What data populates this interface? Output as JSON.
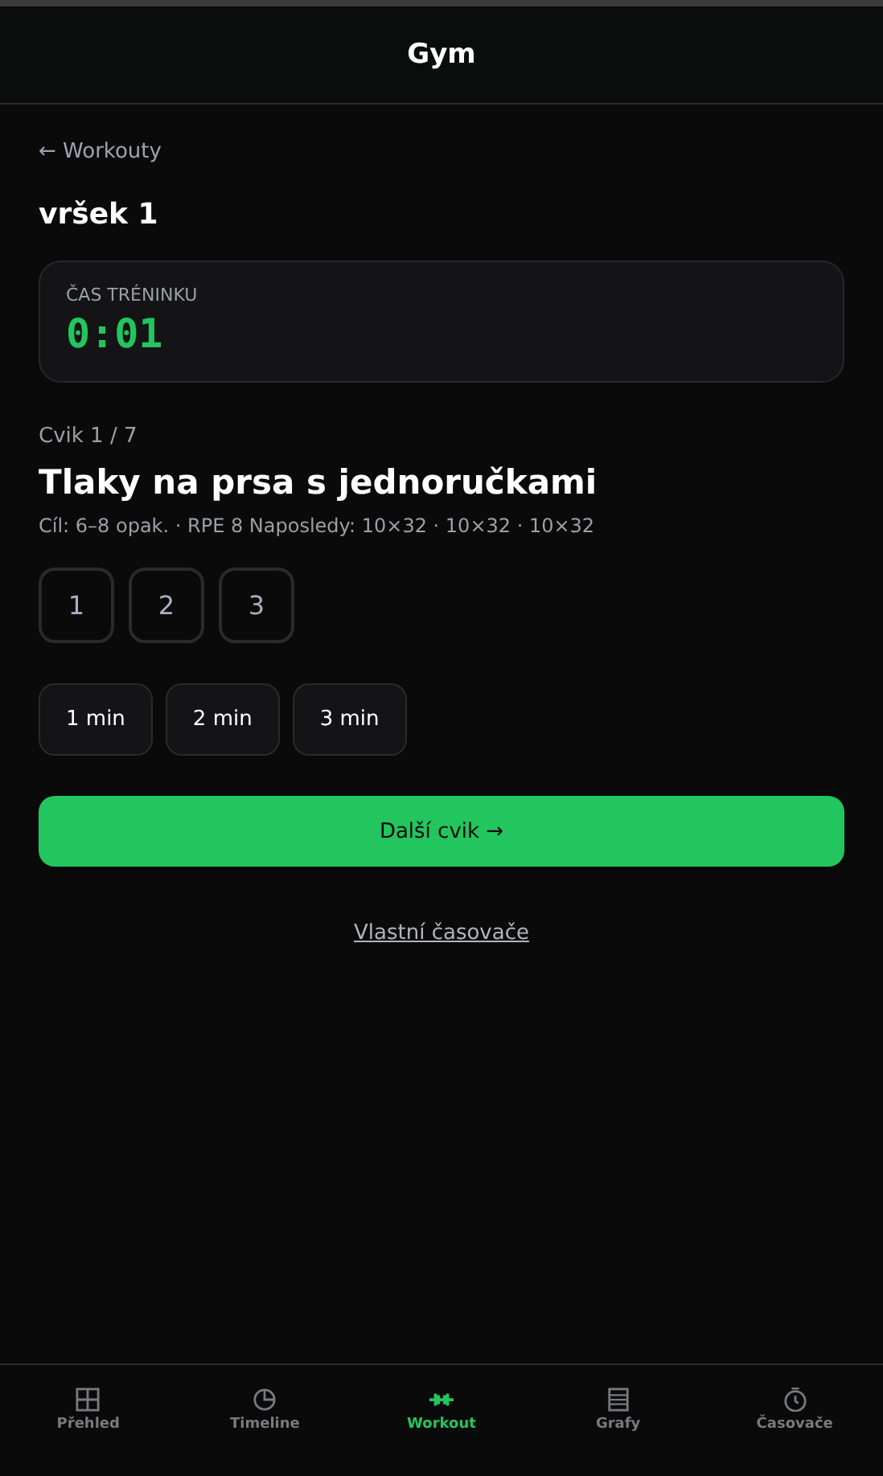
{
  "header": {
    "title": "Gym"
  },
  "back_link": "← Workouty",
  "workout_title": "vršek 1",
  "timer": {
    "label": "ČAS TRÉNINKU",
    "value": "0:01"
  },
  "exercise": {
    "counter": "Cvik 1 / 7",
    "name": "Tlaky na prsa s jednoručkami",
    "target": "Cíl: 6–8 opak. · RPE 8 Naposledy: 10×32 · 10×32 · 10×32"
  },
  "sets": [
    "1",
    "2",
    "3"
  ],
  "rest_buttons": [
    "1 min",
    "2 min",
    "3 min"
  ],
  "next_button": "Další cvik →",
  "custom_timers_link": "Vlastní časovače",
  "tabs": [
    {
      "label": "Přehled",
      "selected": false
    },
    {
      "label": "Timeline",
      "selected": false
    },
    {
      "label": "Workout",
      "selected": true
    },
    {
      "label": "Grafy",
      "selected": false
    },
    {
      "label": "Časovače",
      "selected": false
    }
  ]
}
